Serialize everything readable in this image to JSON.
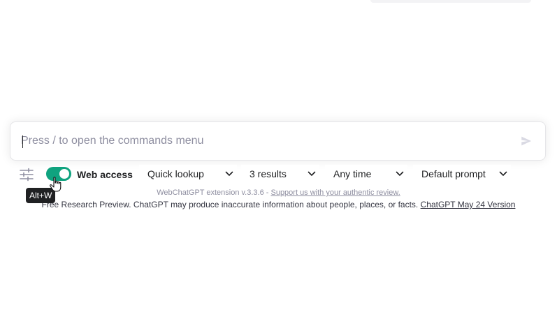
{
  "prompt": {
    "placeholder": "Press / to open the commands menu",
    "send_icon": "send-icon"
  },
  "toolbar": {
    "settings_icon": "sliders-icon",
    "web_access": {
      "label": "Web access",
      "enabled": true,
      "accent_color": "#10a37f"
    },
    "selects": [
      {
        "value": "Quick lookup"
      },
      {
        "value": "3 results"
      },
      {
        "value": "Any time"
      },
      {
        "value": "Default prompt"
      }
    ]
  },
  "tooltip": {
    "text": "Alt+W"
  },
  "extension_line": {
    "version_text": "WebChatGPT extension v.3.3.6 - ",
    "support_link": "Support us with your authentic review."
  },
  "footer": {
    "disclaimer": "Free Research Preview. ChatGPT may produce inaccurate information about people, places, or facts. ",
    "version_link": "ChatGPT May 24 Version"
  }
}
